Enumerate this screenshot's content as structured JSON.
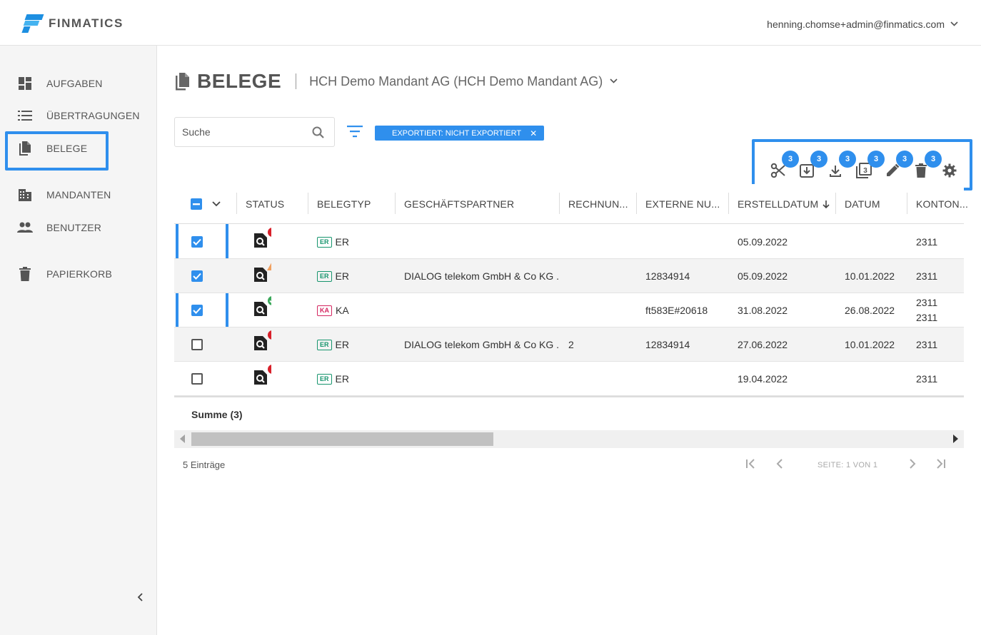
{
  "header": {
    "brand": "FINMATICS",
    "user_email": "henning.chomse+admin@finmatics.com"
  },
  "sidebar": {
    "items": [
      {
        "label": "AUFGABEN",
        "icon": "dashboard-icon"
      },
      {
        "label": "ÜBERTRAGUNGEN",
        "icon": "list-icon"
      },
      {
        "label": "BELEGE",
        "icon": "file-copy-icon",
        "active": true
      },
      {
        "label": "MANDANTEN",
        "icon": "building-icon"
      },
      {
        "label": "BENUTZER",
        "icon": "people-icon"
      },
      {
        "label": "PAPIERKORB",
        "icon": "trash-icon"
      }
    ]
  },
  "page": {
    "title": "BELEGE",
    "mandant": "HCH Demo Mandant AG (HCH Demo Mandant AG)"
  },
  "search": {
    "placeholder": "Suche",
    "value": ""
  },
  "filter_chip": "EXPORTIERT: NICHT EXPORTIERT",
  "toolbar": {
    "badges": [
      "3",
      "3",
      "3",
      "3",
      "3",
      "3"
    ],
    "actions": [
      "scissors-icon",
      "export-icon",
      "download-icon",
      "copy-icon",
      "edit-icon",
      "delete-icon",
      "settings-icon"
    ]
  },
  "table": {
    "columns": [
      "STATUS",
      "BELEGTYP",
      "GESCHÄFTSPARTNER",
      "RECHNUN...",
      "EXTERNE NU...",
      "ERSTELLDATUM",
      "DATUM",
      "KONTON..."
    ],
    "rows": [
      {
        "checked": true,
        "status": "error",
        "type_tag": "ER",
        "type": "ER",
        "partner": "",
        "rechnung": "",
        "extern": "",
        "erstell": "05.09.2022",
        "datum": "",
        "konto": "2311",
        "konto2": ""
      },
      {
        "checked": true,
        "status": "warning",
        "type_tag": "ER",
        "type": "ER",
        "partner": "DIALOG telekom GmbH & Co KG ...",
        "rechnung": "",
        "extern": "12834914",
        "erstell": "05.09.2022",
        "datum": "10.01.2022",
        "konto": "2311",
        "konto2": ""
      },
      {
        "checked": true,
        "status": "success",
        "type_tag": "KA",
        "type": "KA",
        "partner": "",
        "rechnung": "",
        "extern": "ft583E#20618",
        "erstell": "31.08.2022",
        "datum": "26.08.2022",
        "konto": "2311",
        "konto2": "2311"
      },
      {
        "checked": false,
        "status": "error",
        "type_tag": "ER",
        "type": "ER",
        "partner": "DIALOG telekom GmbH & Co KG ...",
        "rechnung": "2",
        "extern": "12834914",
        "erstell": "27.06.2022",
        "datum": "10.01.2022",
        "konto": "2311",
        "konto2": ""
      },
      {
        "checked": false,
        "status": "error",
        "type_tag": "ER",
        "type": "ER",
        "partner": "",
        "rechnung": "",
        "extern": "",
        "erstell": "19.04.2022",
        "datum": "",
        "konto": "2311",
        "konto2": ""
      }
    ],
    "sum_label": "Summe (3)"
  },
  "footer": {
    "count": "5 Einträge",
    "page_label": "SEITE: 1 VON 1"
  },
  "colors": {
    "accent": "#2f8fed",
    "er_tag": "#17956e",
    "ka_tag": "#d42660",
    "error": "#d8202a",
    "warning": "#f0a060",
    "success": "#3aa85a"
  }
}
